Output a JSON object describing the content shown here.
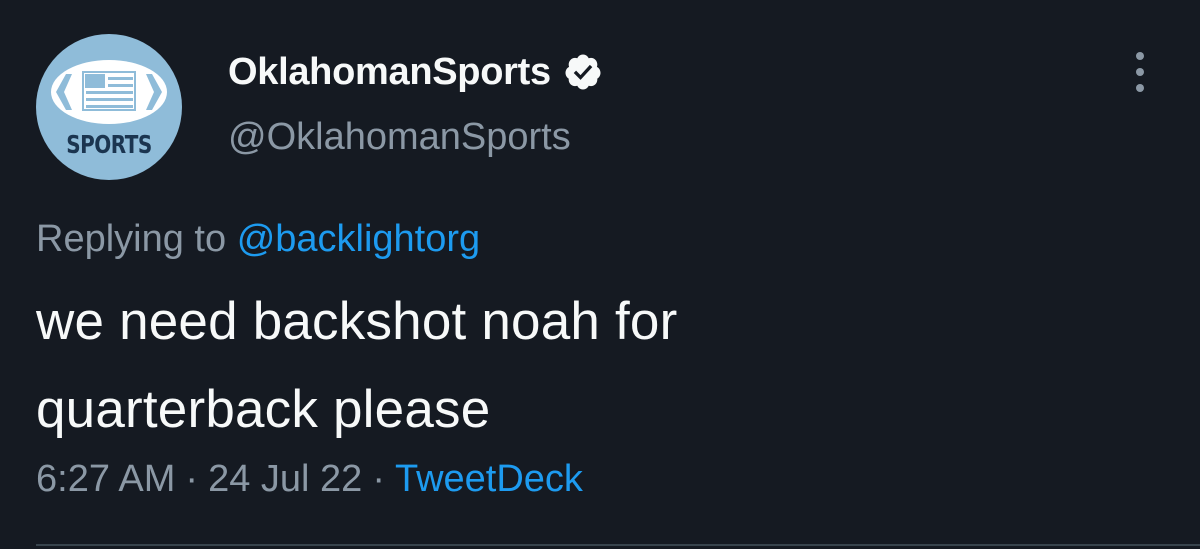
{
  "tweet": {
    "display_name": "OklahomanSports",
    "handle": "@OklahomanSports",
    "avatar_text": "SPORTS",
    "replying_prefix": "Replying to",
    "replying_to": "@backlightorg",
    "text_line_1": "we need backshot noah for",
    "text_line_2": "quarterback please",
    "time": "6:27 AM",
    "separator": "·",
    "date": "24 Jul 22",
    "source": "TweetDeck"
  },
  "icons": {
    "verified": "verified-badge-icon",
    "more": "more-options-icon",
    "avatar": "football-flag-logo"
  },
  "colors": {
    "background": "#151a22",
    "text": "#f7f9f9",
    "secondary": "#8b98a5",
    "accent": "#1d9bf0",
    "avatar_bg": "#8fbcd9"
  }
}
